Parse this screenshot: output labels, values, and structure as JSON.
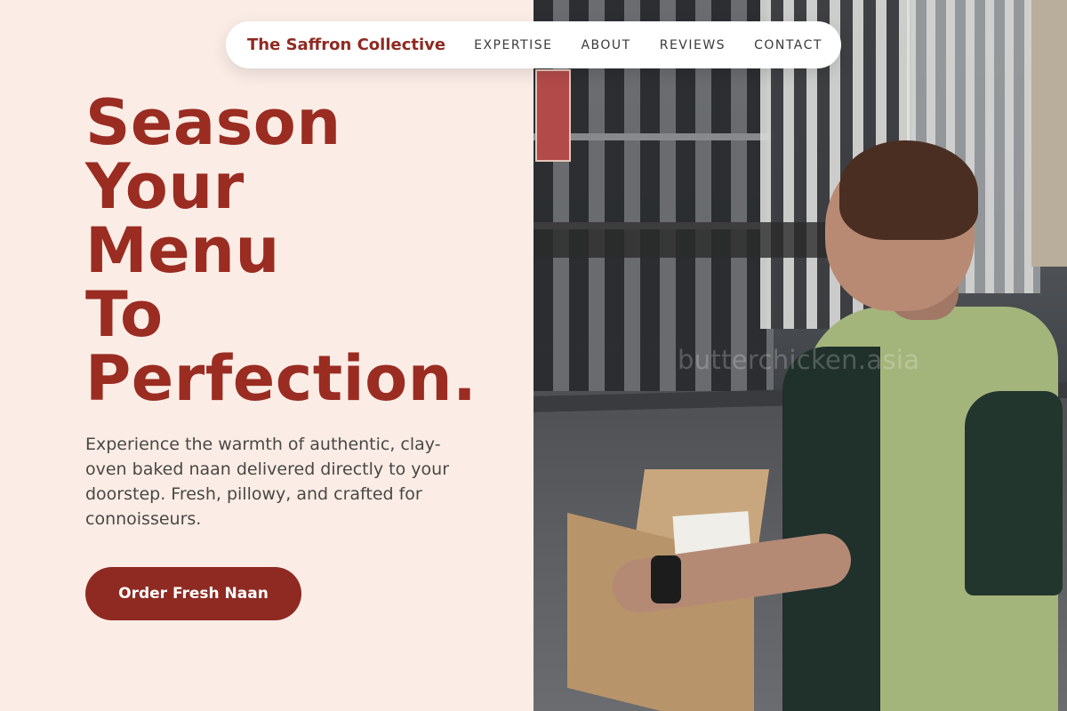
{
  "nav": {
    "brand": "The Saffron Collective",
    "links": [
      "EXPERTISE",
      "ABOUT",
      "REVIEWS",
      "CONTACT"
    ]
  },
  "hero": {
    "headline_lines": [
      "Season",
      "Your",
      "Menu",
      "To",
      "Perfection."
    ],
    "description": "Experience the warmth of authentic, clay-oven baked naan delivered directly to your doorstep. Fresh, pillowy, and crafted for connoisseurs.",
    "cta_label": "Order Fresh Naan"
  },
  "image": {
    "watermark": "butterchicken.asia"
  },
  "colors": {
    "accent": "#9a2c22",
    "button": "#8f2a22",
    "background": "#fbede6",
    "body_text": "#4a4744"
  }
}
